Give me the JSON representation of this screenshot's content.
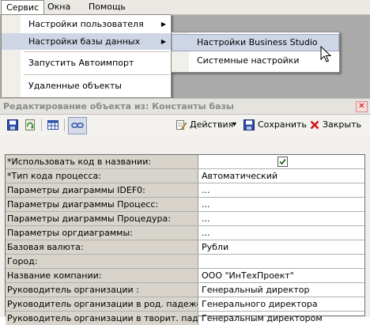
{
  "menubar": {
    "items": [
      {
        "label": "Сервис"
      },
      {
        "label": "Окна"
      },
      {
        "label": "Помощь"
      }
    ]
  },
  "dropdown": {
    "items": [
      {
        "label": "Настройки пользователя",
        "submenu_arrow": "▶"
      },
      {
        "label": "Настройки базы данных",
        "submenu_arrow": "▶"
      },
      {
        "label": "Запустить Автоимпорт"
      },
      {
        "label": "Удаленные объекты"
      }
    ]
  },
  "submenu": {
    "items": [
      {
        "label": "Настройки Business Studio"
      },
      {
        "label": "Системные настройки"
      }
    ]
  },
  "window": {
    "title": "Редактирование объекта из: Константы базы",
    "close_glyph": "✕"
  },
  "toolbar": {
    "icons": [
      "save-icon",
      "refresh-icon",
      "grid-icon",
      "link-icon"
    ],
    "actions_label": "Действия",
    "actions_arrow": "▾",
    "save_label": "Сохранить",
    "close_label": "Закрыть"
  },
  "properties": [
    {
      "name": "*Использовать код в названии:",
      "value": "",
      "checked": true
    },
    {
      "name": "*Тип кода процесса:",
      "value": "Автоматический"
    },
    {
      "name": "Параметры диаграммы IDEF0:",
      "value": "..."
    },
    {
      "name": "Параметры диаграммы Процесс:",
      "value": "..."
    },
    {
      "name": "Параметры диаграммы Процедура:",
      "value": "..."
    },
    {
      "name": "Параметры оргдиаграммы:",
      "value": "..."
    },
    {
      "name": "Базовая валюта:",
      "value": "Рубли"
    },
    {
      "name": "Город:",
      "value": ""
    },
    {
      "name": "Название компании:",
      "value": "ООО \"ИнТехПроект\""
    },
    {
      "name": "Руководитель организации :",
      "value": "Генеральный директор"
    },
    {
      "name": "Руководитель организации в род. падеже:",
      "value": "Генерального директора"
    },
    {
      "name": "Руководитель организации в творит. падеже:",
      "value": "Генеральным директором"
    }
  ],
  "colors": {
    "menu_highlight": "#ced6e6",
    "label_cell_bg": "#d8d4cc",
    "gray_area": "#aaaaaa",
    "close_red": "#c00000"
  }
}
